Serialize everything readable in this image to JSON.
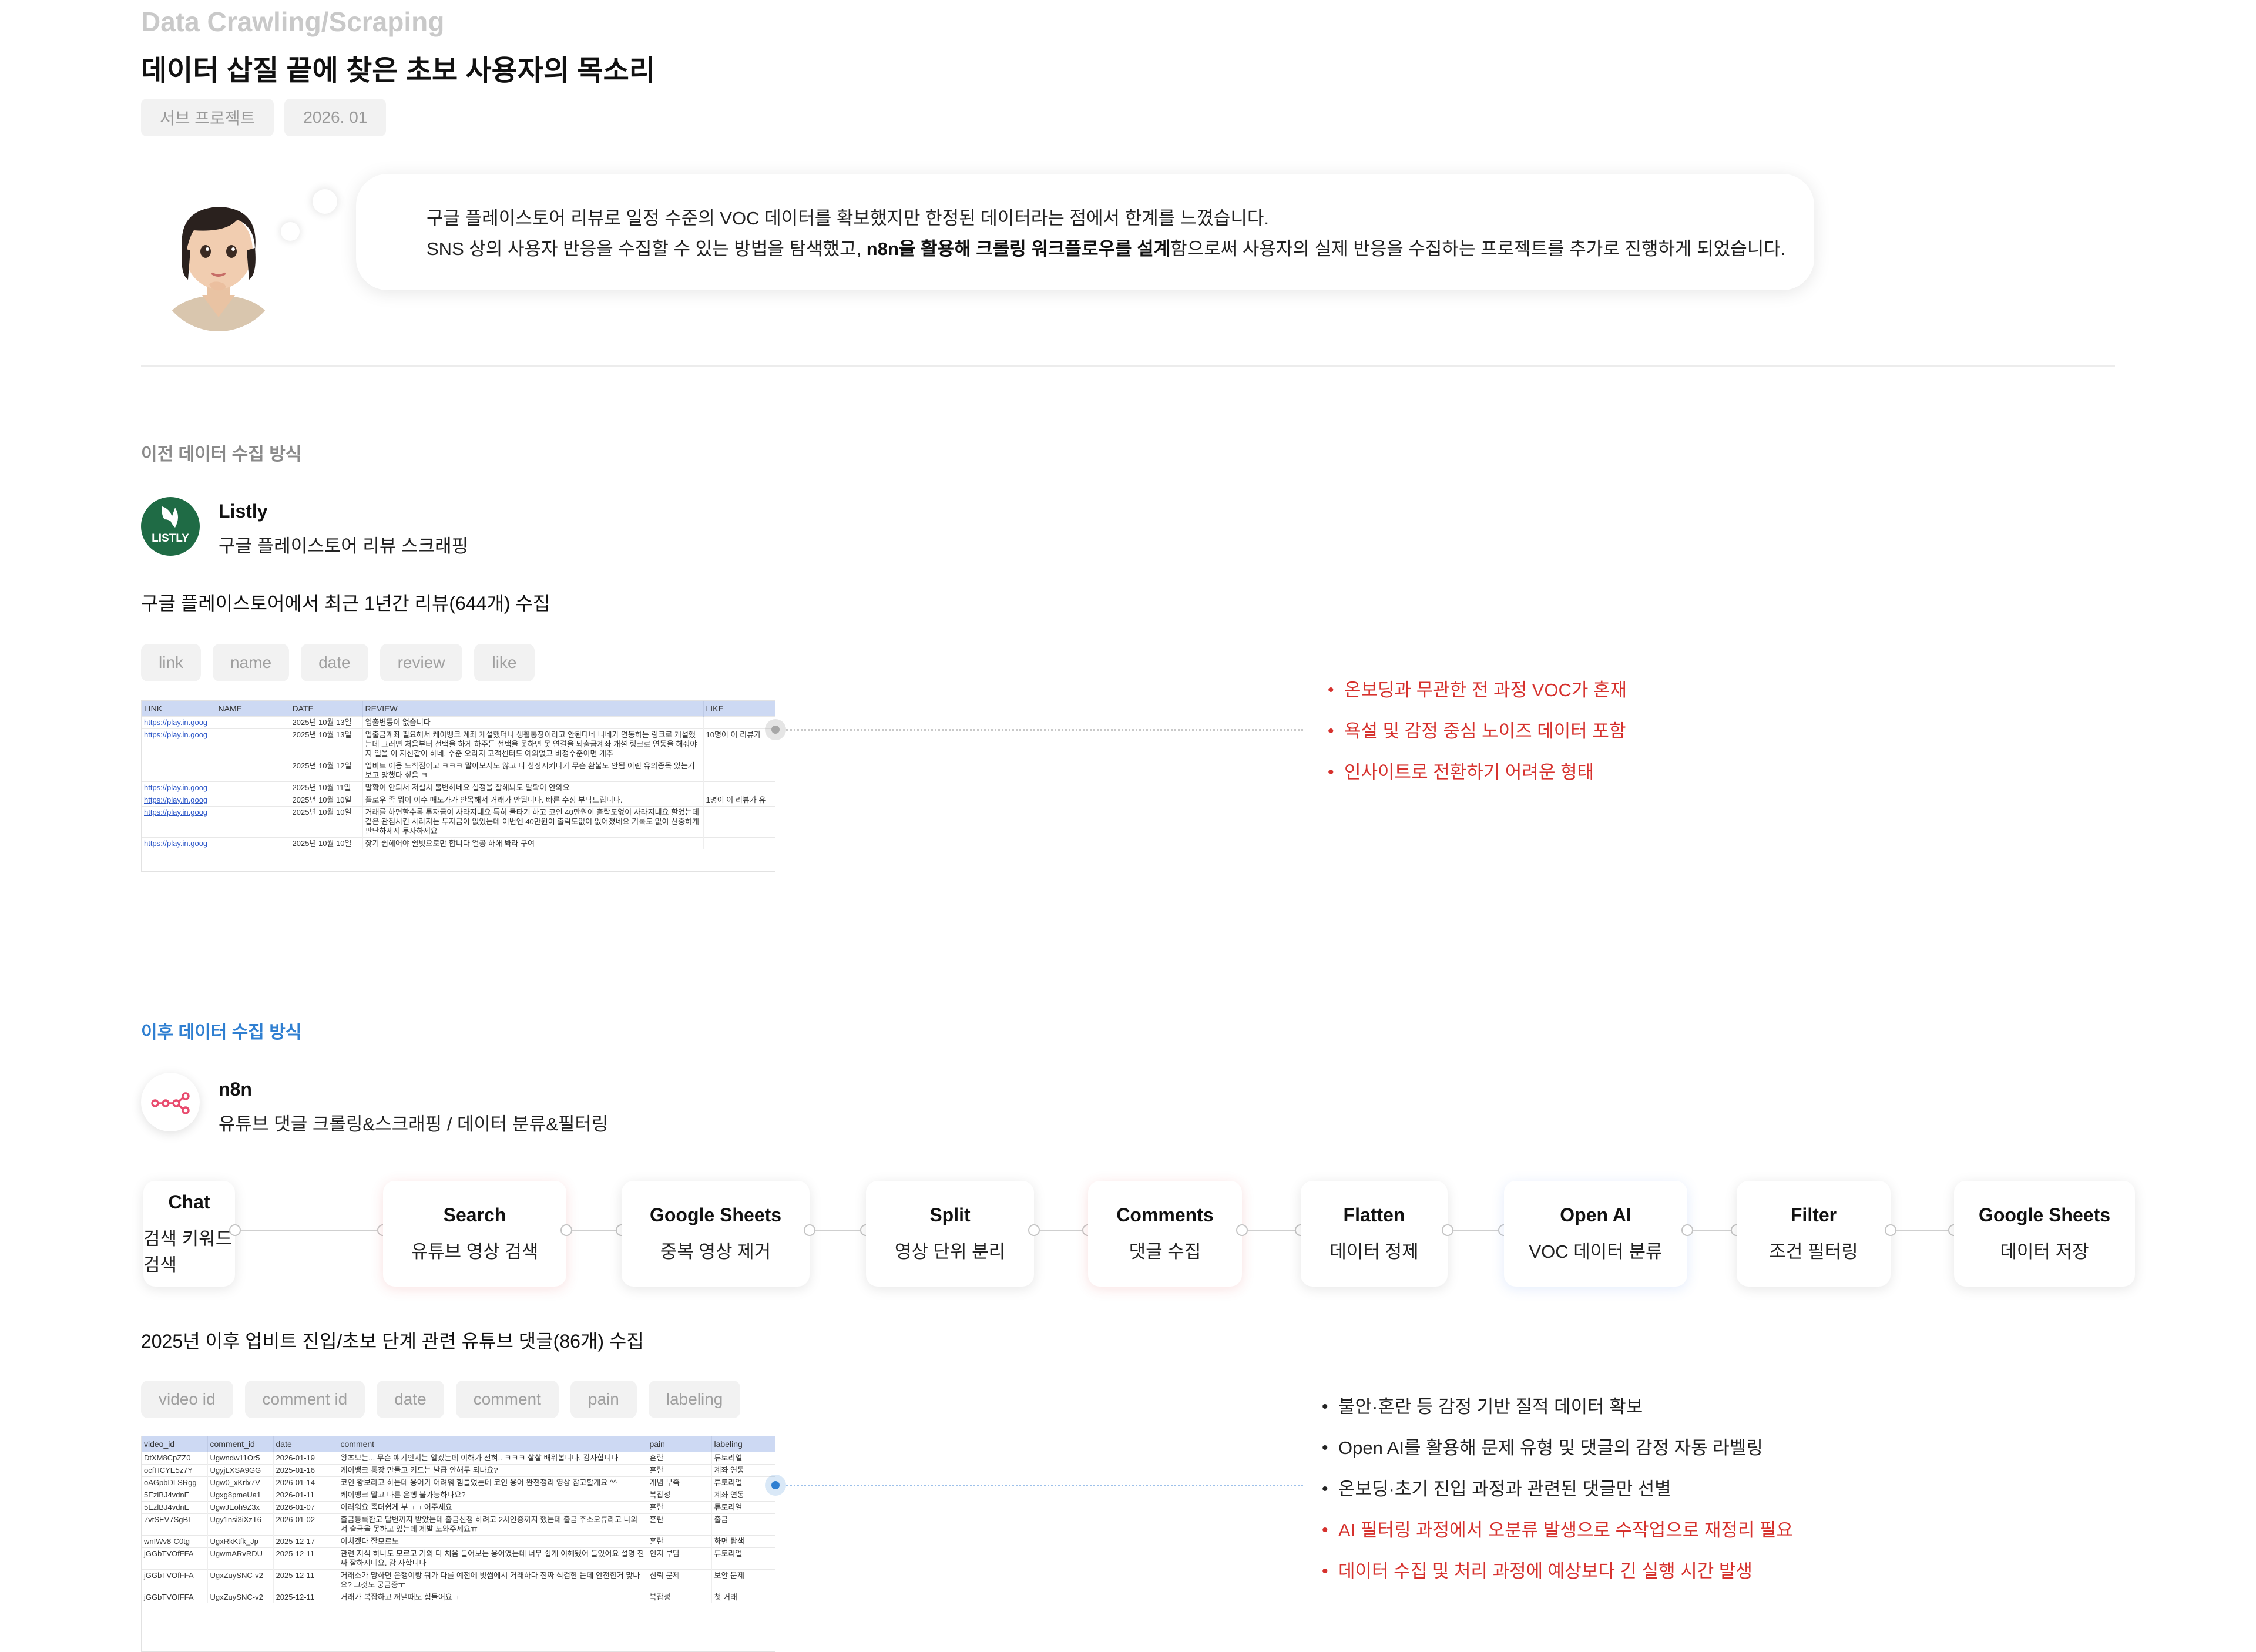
{
  "header": {
    "eyebrow": "Data Crawling/Scraping",
    "title": "데이터 삽질 끝에 찾은 초보 사용자의 목소리",
    "tags": [
      "서브 프로젝트",
      "2026. 01"
    ]
  },
  "intro": {
    "line1": "구글 플레이스토어 리뷰로 일정 수준의 VOC 데이터를 확보했지만 한정된 데이터라는 점에서 한계를 느꼈습니다.",
    "line2_pre": "SNS 상의 사용자 반응을 수집할 수 있는 방법을 탐색했고, ",
    "line2_bold": "n8n을 활용해 크롤링 워크플로우를 설계",
    "line2_post": "함으로써 사용자의 실제 반응을 수집하는 프로젝트를 추가로 진행하게 되었습니다."
  },
  "before": {
    "label": "이전 데이터 수집 방식",
    "tool_name": "Listly",
    "tool_logo_text": "LISTLY",
    "tool_desc": "구글 플레이스토어 리뷰 스크래핑",
    "summary": "구글 플레이스토어에서 최근 1년간 리뷰(644개) 수집",
    "fields": [
      "link",
      "name",
      "date",
      "review",
      "like"
    ],
    "sheet_headers": [
      "LINK",
      "NAME",
      "DATE",
      "REVIEW",
      "LIKE"
    ],
    "sheet_rows": [
      [
        "https://play.in.goog",
        "",
        "2025년 10월 13일",
        "입출변동이 없습니다",
        ""
      ],
      [
        "https://play.in.goog",
        "",
        "2025년 10월 13일",
        "입출금계좌 필요해서 케이뱅크 계좌 개설했더니 생활통장이라고 안된다네 니네가 연동하는 링크로 개설했는데 그러면 처음부터 선택을 하게 하주든 선택을 못하면 못 연결을 되출금계좌 개설 링크로 연동을 해줘야지 일을 이 지신같이 하네. 수준 오라지 고객센터도 예의없고 비정수준이면 개추",
        "10명이 이 리뷰가"
      ],
      [
        "",
        "",
        "2025년 10월 12일",
        "업비트 이용 도착점이고 ㅋㅋㅋ 말아보지도 않고 다 상장시키다가 무슨 환불도 안됨 이런 유의종목 있는거보고 망했다 싶음 ㅋ",
        ""
      ],
      [
        "https://play.in.goog",
        "",
        "2025년 10월 11일",
        "말확이 안되서 저설치 불변하네요 설정을 잘해놔도 말확이 안와요",
        ""
      ],
      [
        "https://play.in.goog",
        "",
        "2025년 10월 10일",
        "플로우 좀 뭐이 이수 매도가가 안목해서 거래가 안됩니다. 빠른 수정 부탁드립니다.",
        "1명이 이 리뷰가 유"
      ],
      [
        "https://play.in.goog",
        "",
        "2025년 10월 10일",
        "거래를 하면할수록 투자금이 사라지네요 특히 물타기 하고 코인 40만원이 출락도없이 사라지네요 할었는데 같은 관점시킨 사라지는 투자금이 없었는데 이번엔 40만원이 출락도없이 없어졌네요 기록도 없이 신중하게 판단하세서 투자하세요",
        ""
      ],
      [
        "https://play.in.goog",
        "",
        "2025년 10월 10일",
        "찾기 쉽헤어야 쉴빗으로만 합니다 얼공 하해 봐라 구여",
        ""
      ]
    ],
    "issues": [
      "온보딩과 무관한 전 과정 VOC가 혼재",
      "욕설 및 감정 중심 노이즈 데이터 포함",
      "인사이트로 전환하기 어려운 형태"
    ]
  },
  "after": {
    "label": "이후 데이터 수집 방식",
    "tool_name": "n8n",
    "tool_desc": "유튜브 댓글 크롤링&스크래핑 / 데이터 분류&필터링",
    "workflow": [
      {
        "title": "Chat",
        "desc": "검색 키워드 검색",
        "tone": "none"
      },
      {
        "title": "Search",
        "desc": "유튜브 영상 검색",
        "tone": "red"
      },
      {
        "title": "Google Sheets",
        "desc": "중복 영상 제거",
        "tone": "none"
      },
      {
        "title": "Split",
        "desc": "영상 단위 분리",
        "tone": "none"
      },
      {
        "title": "Comments",
        "desc": "댓글 수집",
        "tone": "red"
      },
      {
        "title": "Flatten",
        "desc": "데이터 정제",
        "tone": "none"
      },
      {
        "title": "Open AI",
        "desc": "VOC 데이터 분류",
        "tone": "blue"
      },
      {
        "title": "Filter",
        "desc": "조건 필터링",
        "tone": "none"
      },
      {
        "title": "Google Sheets",
        "desc": "데이터 저장",
        "tone": "none"
      }
    ],
    "summary": "2025년 이후 업비트 진입/초보 단계 관련 유튜브 댓글(86개) 수집",
    "fields": [
      "video id",
      "comment id",
      "date",
      "comment",
      "pain",
      "labeling"
    ],
    "sheet_headers": [
      "video_id",
      "comment_id",
      "date",
      "comment",
      "pain",
      "labeling"
    ],
    "sheet_rows": [
      [
        "DtXM8CpZZ0",
        "Ugwndw11Or5",
        "2026-01-19",
        "왕초보는... 무슨 얘기인지는 알겠는데 이해가 전혀.. ㅋㅋㅋ 살살 배워봅니다. 감사합니다",
        "혼란",
        "튜토리얼"
      ],
      [
        "ocfHCYE5z7Y",
        "UgyjLXSA9GG",
        "2025-01-16",
        "케이뱅크 통장 만들고 키드는 발급 안해두 되나요?",
        "혼란",
        "계좌 연동"
      ],
      [
        "oAGpbDLSRgg",
        "Ugw0_xKrlx7V",
        "2026-01-14",
        "코인 왕보라고 하는데 용어가 어려워 힘들었는데 코인 용어 완전정리 영상 참고할게요 ^^",
        "개념 부족",
        "튜토리얼"
      ],
      [
        "5EzlBJ4vdnE",
        "Ugxg8pmeUa1",
        "2026-01-11",
        "케이뱅크 말고 다른 은행 불가능하나요?",
        "복잡성",
        "계좌 연동"
      ],
      [
        "5EzlBJ4vdnE",
        "UgwJEoh9Z3x",
        "2026-01-07",
        "이러워요 좀더쉽게 부 ㅜㅜ어주세요",
        "혼란",
        "튜토리얼"
      ],
      [
        "7vtSEV7SgBI",
        "Ugy1nsi3iXzT6",
        "2026-01-02",
        "출금등록한고 답변까지 받았는데 출금신청 하려고 2차인증까지 했는데 출금 주소오류라고 나와서 출금을 못하고 있는데 제발 도와주세요ㅠ",
        "혼란",
        "출금"
      ],
      [
        "wnIWv8-C0tg",
        "UgxRkKtfk_Jp",
        "2025-12-17",
        "이치겠다 잘모르노",
        "혼란",
        "화면 탐색"
      ],
      [
        "jGGbTVOfFFA",
        "UgwmARvRDU",
        "2025-12-11",
        "관련 지식 하나도 모르고 거의 다 처음 들어보는 용어였는데 너무 쉽게 이해됐어 들었어요 설명 진짜 잘하시네요. 감 사합니다",
        "인지 부담",
        "튜토리얼"
      ],
      [
        "jGGbTVOfFFA",
        "UgxZuySNC-v2",
        "2025-12-11",
        "거래소가 망하면 은행이랑 뭐가 다를 예전에 빗썸에서 거래하다 진짜 식겁한 는데 안전한거 맞나요? 그것도 궁금증ㅜ",
        "신뢰 문제",
        "보안 문제"
      ],
      [
        "jGGbTVOfFFA",
        "UgxZuySNC-v2",
        "2025-12-11",
        "거래가 복잡하고 꺼낼때도 힘들어요 ㅜ",
        "복잡성",
        "첫 거래"
      ]
    ],
    "results": [
      {
        "text": "불안·혼란 등 감정 기반 질적 데이터 확보",
        "tone": "dark"
      },
      {
        "text": "Open AI를 활용해 문제 유형 및 댓글의 감정 자동 라벨링",
        "tone": "dark"
      },
      {
        "text": "온보딩·초기 진입 과정과 관련된 댓글만 선별",
        "tone": "dark"
      },
      {
        "text": "AI 필터링 과정에서 오분류 발생으로 수작업으로 재정리 필요",
        "tone": "red"
      },
      {
        "text": "데이터 수집 및 처리 과정에 예상보다 긴 실행 시간 발생",
        "tone": "red"
      }
    ]
  },
  "colors": {
    "accent_blue": "#2f7fd1",
    "issue_red": "#d6312d",
    "listly_green": "#1f6b45",
    "n8n_pink": "#e84a6d"
  },
  "icons": {
    "bullet": "•",
    "listly": "listly-logo-icon",
    "n8n": "n8n-logo-icon",
    "avatar": "avatar-illustration"
  }
}
